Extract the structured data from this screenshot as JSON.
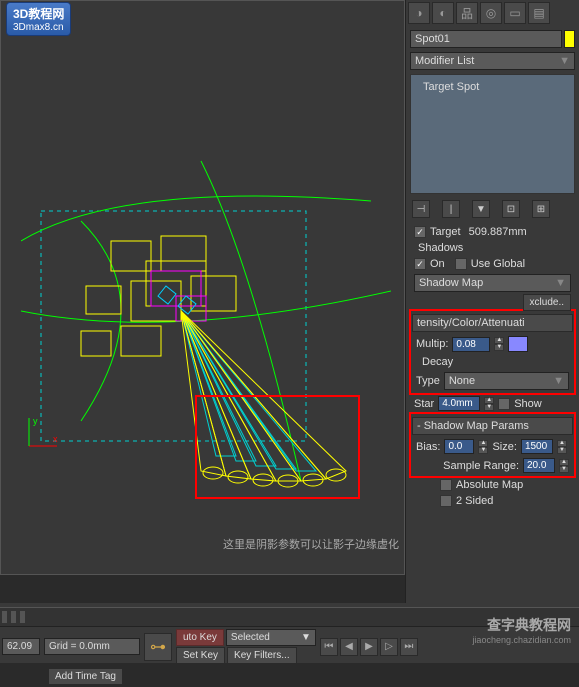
{
  "logo": {
    "line1": "3D教程网",
    "line2": "3Dmax8.cn"
  },
  "viewport": {
    "annotation": "这里是阴影参数可以让影子边缘虚化"
  },
  "topIcons": [
    "◑",
    "◐",
    "品",
    "◎",
    "▭",
    "▤"
  ],
  "object": {
    "name": "Spot01"
  },
  "modifierList": {
    "label": "Modifier List",
    "arrow": "▼"
  },
  "stack": {
    "item": "Target Spot"
  },
  "stackBtns": [
    "⊣",
    "|",
    "▼",
    "⊡",
    "⊞"
  ],
  "general": {
    "target": {
      "label": "Target",
      "value": "509.887mm"
    }
  },
  "shadows": {
    "title": "Shadows",
    "on": "On",
    "useGlobal": "Use Global",
    "mapType": "Shadow Map",
    "arrow": "▼",
    "exclude": "xclude.."
  },
  "intensity": {
    "rollout": "tensity/Color/Attenuati",
    "multipLabel": "Multip:",
    "multipValue": "0.08",
    "decayLabel": "Decay",
    "typeLabel": "Type",
    "typeValue": "None",
    "arrow": "▼",
    "starLabel": "Star",
    "starValue": "4.0mm",
    "show": "Show"
  },
  "shadowMap": {
    "rollout": "-  Shadow Map Params",
    "biasLabel": "Bias:",
    "biasValue": "0.0",
    "sizeLabel": "Size:",
    "sizeValue": "1500",
    "sampleLabel": "Sample Range:",
    "sampleValue": "20.0",
    "absMap": "Absolute Map",
    "twoSided": "2 Sided"
  },
  "bottom": {
    "coord": "62.09",
    "grid": "Grid = 0.0mm",
    "autoKey": "uto Key",
    "selected": "Selected",
    "arrow": "▼",
    "setKey": "Set Key",
    "keyFilters": "Key Filters...",
    "addTimeTag": "Add Time Tag"
  },
  "playback": [
    "⏮",
    "◀",
    "⏹",
    "▶",
    "▷",
    "⏭",
    "◧",
    "⊞",
    "⊡"
  ],
  "watermark": {
    "logo": "查字典教程网",
    "url": "jiaocheng.chazidian.com"
  }
}
